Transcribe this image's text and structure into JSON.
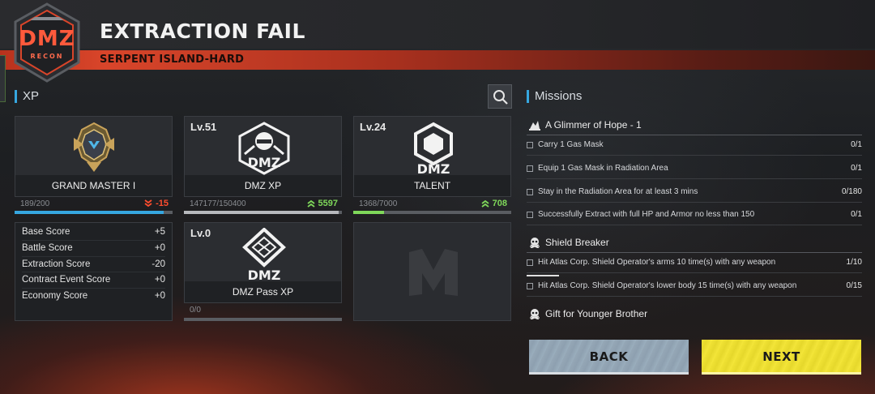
{
  "header": {
    "logo_text": "DMZ",
    "logo_sub": "RECON",
    "title": "EXTRACTION FAIL",
    "subtitle": "SERPENT ISLAND-HARD"
  },
  "xp_section": {
    "label": "XP",
    "cards": [
      {
        "level": "",
        "label": "GRAND MASTER I",
        "progress": "189/200",
        "delta": "-15",
        "fill": 0.945,
        "color": "#36a7e0"
      },
      {
        "level": "Lv.51",
        "label": "DMZ XP",
        "progress": "147177/150400",
        "delta": "5597",
        "fill": 0.98,
        "color": "#b7b9bd"
      },
      {
        "level": "Lv.24",
        "label": "TALENT",
        "progress": "1368/7000",
        "delta": "708",
        "fill": 0.195,
        "color": "#7fd85a"
      },
      {
        "level": "Lv.0",
        "label": "DMZ Pass XP",
        "progress": "0/0"
      }
    ],
    "scores": [
      {
        "name": "Base Score",
        "value": "+5"
      },
      {
        "name": "Battle Score",
        "value": "+0"
      },
      {
        "name": "Extraction Score",
        "value": "-20"
      },
      {
        "name": "Contract Event Score",
        "value": "+0"
      },
      {
        "name": "Economy Score",
        "value": "+0"
      }
    ]
  },
  "missions": {
    "label": "Missions",
    "groups": [
      {
        "title": "A Glimmer of Hope - 1",
        "tasks": [
          {
            "text": "Carry 1 Gas Mask",
            "count": "0/1"
          },
          {
            "text": "Equip 1 Gas Mask in Radiation Area",
            "count": "0/1"
          },
          {
            "text": "Stay in the Radiation Area for at least 3 mins",
            "count": "0/180"
          },
          {
            "text": "Successfully Extract with full HP and Armor no less than 150",
            "count": "0/1"
          }
        ]
      },
      {
        "title": "Shield Breaker",
        "tasks": [
          {
            "text": "Hit Atlas Corp. Shield Operator's arms 10 time(s) with any weapon",
            "count": "1/10"
          },
          {
            "text": "Hit Atlas Corp. Shield Operator's lower body 15 time(s) with any weapon",
            "count": "0/15"
          }
        ]
      },
      {
        "title": "Gift for Younger Brother",
        "tasks": []
      }
    ]
  },
  "buttons": {
    "back": "BACK",
    "next": "NEXT"
  },
  "colors": {
    "accent_blue": "#36a7e0",
    "positive": "#7fd85a",
    "negative": "#ff4d2e",
    "next_yellow": "#f0e234",
    "back_gray": "#95a7b6"
  }
}
